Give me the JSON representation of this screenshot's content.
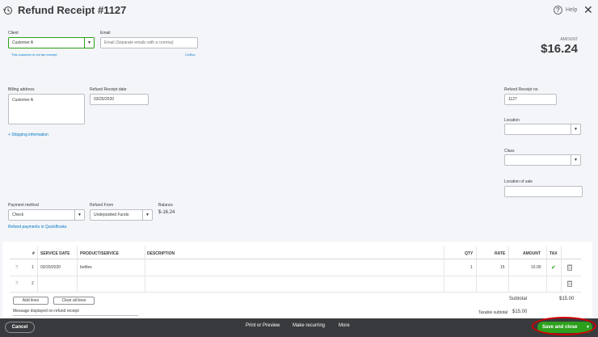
{
  "header": {
    "title": "Refund Receipt #1127",
    "help": "Help",
    "close": "✕"
  },
  "client": {
    "label": "Client",
    "value": "Customer A",
    "tax_note": "This customer is not tax exempt"
  },
  "email": {
    "label": "Email",
    "placeholder": "Email (Separate emails with a comma)",
    "cc_bcc": "Cc/Bcc"
  },
  "amount": {
    "label": "AMOUNT",
    "value": "$16.24"
  },
  "billing": {
    "label": "Billing address",
    "value": "Customer A"
  },
  "refund_date": {
    "label": "Refund Receipt date",
    "value": "03/25/2020"
  },
  "shipping_link": "+ Shipping information",
  "refund_no": {
    "label": "Refund Receipt no.",
    "value": "1127"
  },
  "location": {
    "label": "Location"
  },
  "class": {
    "label": "Class"
  },
  "location_of_sale": {
    "label": "Location of sale"
  },
  "payment_method": {
    "label": "Payment method",
    "value": "Check"
  },
  "refund_from": {
    "label": "Refund From",
    "value": "Undeposited Funds"
  },
  "balance": {
    "label": "Balance",
    "value": "$-16.24"
  },
  "refund_payments_link": "Refund payments in QuickBooks",
  "table": {
    "headers": {
      "num": "#",
      "service_date": "SERVICE DATE",
      "product": "PRODUCT/SERVICE",
      "description": "DESCRIPTION",
      "qty": "QTY",
      "rate": "RATE",
      "amount": "AMOUNT",
      "tax": "TAX"
    },
    "rows": [
      {
        "num": "1",
        "service_date": "03/20/2020",
        "product": "bottles",
        "description": "",
        "qty": "1",
        "rate": "15",
        "amount": "15.00",
        "tax": "✔"
      },
      {
        "num": "2",
        "service_date": "",
        "product": "",
        "description": "",
        "qty": "",
        "rate": "",
        "amount": "",
        "tax": ""
      }
    ]
  },
  "add_lines": "Add lines",
  "clear_lines": "Clear all lines",
  "message_label": "Message displayed on refund receipt",
  "subtotal": {
    "label": "Subtotal",
    "value": "$15.00"
  },
  "taxable_subtotal": {
    "label": "Taxable subtotal",
    "value": "$15.00"
  },
  "footer": {
    "cancel": "Cancel",
    "print": "Print or Preview",
    "recurring": "Make recurring",
    "more": "More",
    "save": "Save and close"
  },
  "colors": {
    "accent_green": "#2ca01c",
    "link_blue": "#0077c5",
    "footer_bg": "#393a3d",
    "highlight_red": "#d40000"
  }
}
